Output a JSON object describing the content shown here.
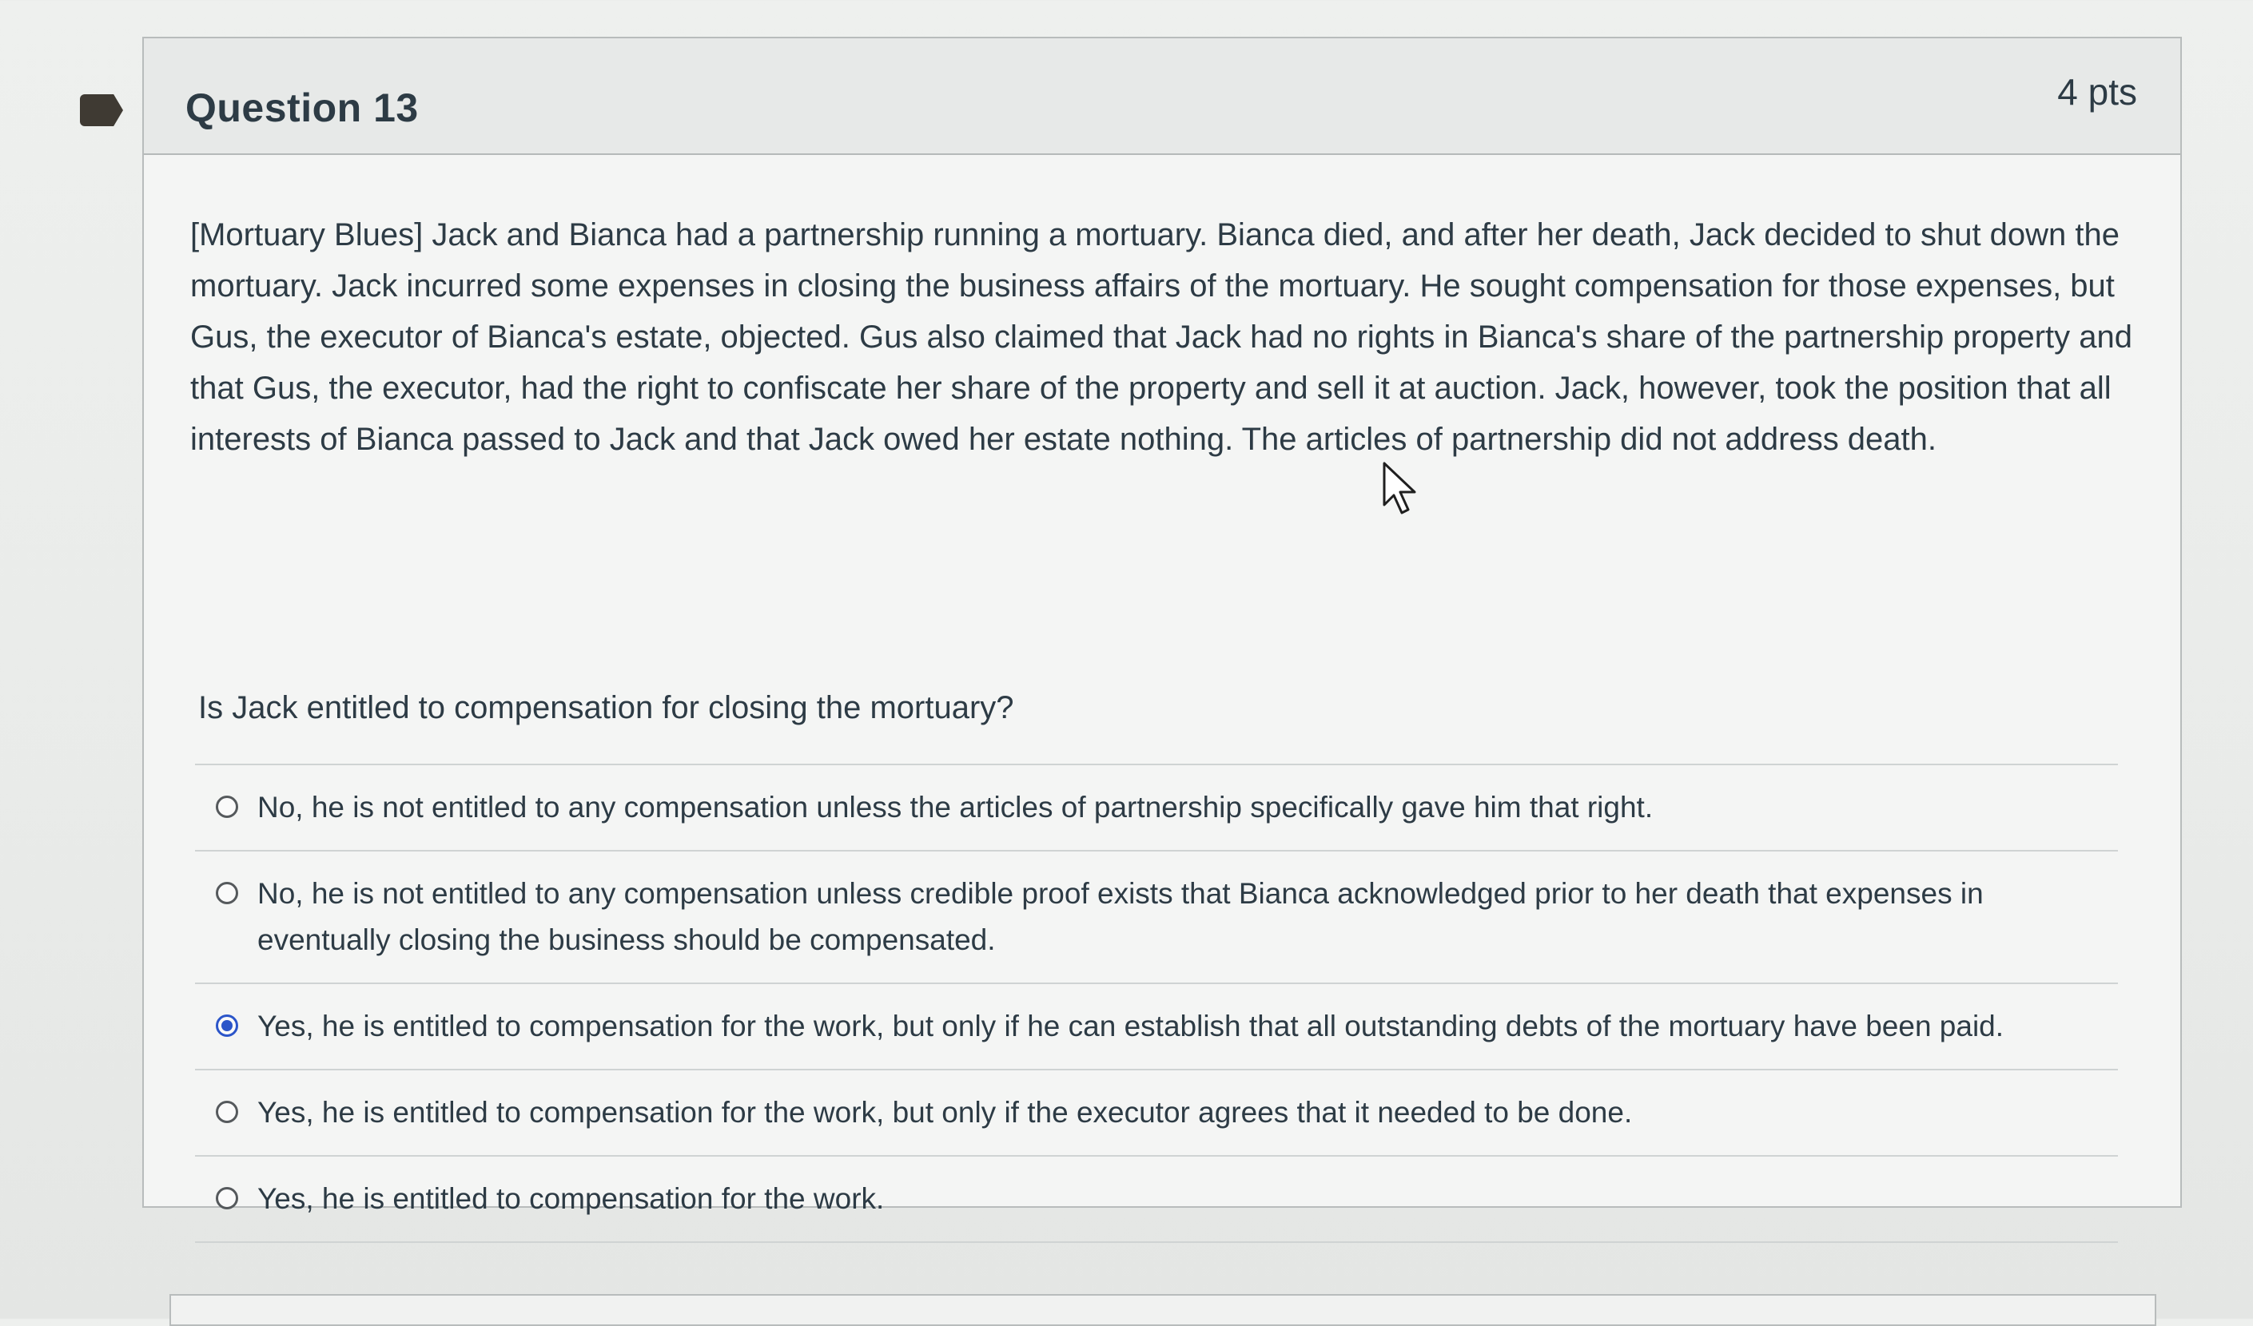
{
  "question": {
    "title": "Question 13",
    "points": "4 pts",
    "text": "[Mortuary Blues] Jack and Bianca had a partnership running a mortuary. Bianca died, and after her death, Jack decided to shut down the mortuary. Jack incurred some expenses in closing the business affairs of the mortuary. He sought compensation for those expenses, but Gus, the executor of Bianca's estate, objected. Gus also claimed that Jack had no rights in Bianca's share of the partnership property and that Gus, the executor, had the right to confiscate her share of the property and sell it at auction. Jack, however, took the position that all interests of Bianca passed to Jack and that Jack owed her estate nothing. The articles of partnership did not address death.",
    "prompt": "Is Jack entitled to compensation for closing the mortuary?",
    "answers": [
      {
        "label": "No, he is not entitled to any compensation unless the articles of partnership specifically gave him that right.",
        "selected": false
      },
      {
        "label": "No, he is not entitled to any compensation unless credible proof exists that Bianca acknowledged prior to her death that expenses in eventually closing the business should be compensated.",
        "selected": false
      },
      {
        "label": "Yes, he is entitled to compensation for the work, but only if he can establish that all outstanding debts of the mortuary have been paid.",
        "selected": true
      },
      {
        "label": "Yes, he is entitled to compensation for the work, but only if the executor agrees that it needed to be done.",
        "selected": false
      },
      {
        "label": "Yes, he is entitled to compensation for the work.",
        "selected": false
      }
    ]
  },
  "icons": {
    "flag": "bookmark-flag-icon",
    "cursor": "mouse-pointer-icon"
  },
  "colors": {
    "accent_radio": "#2b55c9",
    "text": "#2d3b45",
    "flag": "#3f3a33"
  }
}
